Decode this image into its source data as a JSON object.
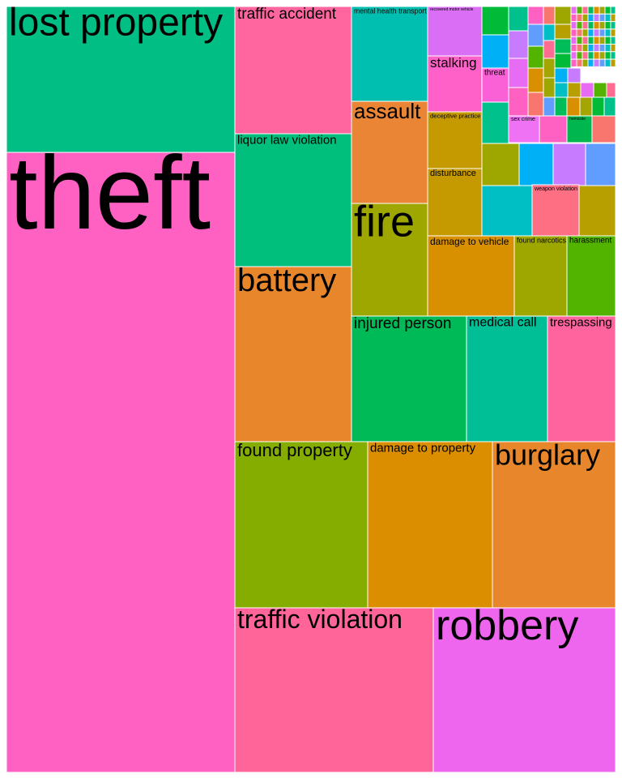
{
  "chart_data": {
    "type": "treemap",
    "labeled": [
      {
        "label": "theft",
        "value": 27.9,
        "color": "#FF61C3"
      },
      {
        "label": "lost property",
        "value": 5.0,
        "color": "#00BE84"
      },
      {
        "label": "traffic accident",
        "value": 3.6,
        "color": "#FF659E"
      },
      {
        "label": "liquor law violation",
        "value": 3.7,
        "color": "#00BE7C"
      },
      {
        "label": "battery",
        "value": 4.9,
        "color": "#E8862C"
      },
      {
        "label": "mental health transport",
        "value": 1.44,
        "color": "#00BFB0"
      },
      {
        "label": "recovered motor vehicle",
        "value": 0.4,
        "color": "#DA6FF6"
      },
      {
        "label": "stalking",
        "value": 0.87,
        "color": "#FF61C9"
      },
      {
        "label": "threat",
        "value": 0.24,
        "color": "#FB61D7"
      },
      {
        "label": "assault",
        "value": 1.64,
        "color": "#E98535"
      },
      {
        "label": "deceptive practice",
        "value": 0.82,
        "color": "#C49A00"
      },
      {
        "label": "disturbance",
        "value": 1.04,
        "color": "#C49A00"
      },
      {
        "label": "fire",
        "value": 1.8,
        "color": "#9DA700"
      },
      {
        "label": "damage to vehicle",
        "value": 1.38,
        "color": "#D89000"
      },
      {
        "label": "found narcotics",
        "value": 0.77,
        "color": "#9DA700"
      },
      {
        "label": "harassment",
        "value": 0.72,
        "color": "#53B400"
      },
      {
        "label": "sex crime",
        "value": 0.21,
        "color": "#EE72F3"
      },
      {
        "label": "homicide",
        "value": 0.14,
        "color": "#00B64F"
      },
      {
        "label": "weapon violation",
        "value": 0.51,
        "color": "#FF6F83"
      },
      {
        "label": "injured person",
        "value": 2.8,
        "color": "#00BA58"
      },
      {
        "label": "medical call",
        "value": 2.3,
        "color": "#00BF96"
      },
      {
        "label": "trespassing",
        "value": 2.2,
        "color": "#FF649E"
      },
      {
        "label": "found property",
        "value": 4.9,
        "color": "#85AD00"
      },
      {
        "label": "damage to property",
        "value": 4.6,
        "color": "#DB8E00"
      },
      {
        "label": "burglary",
        "value": 4.6,
        "color": "#E8862C"
      },
      {
        "label": "traffic violation",
        "value": 7.1,
        "color": "#FF6599"
      },
      {
        "label": "robbery",
        "value": 6.3,
        "color": "#EE66EE"
      }
    ],
    "unlabeled_tiles": 150
  }
}
